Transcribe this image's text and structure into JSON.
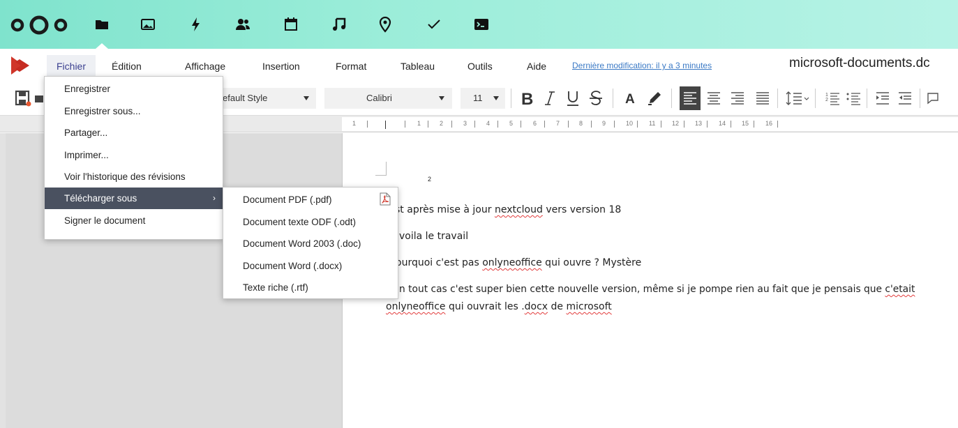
{
  "nextcloud": {
    "apps": [
      "logo-icon",
      "files-icon",
      "photos-icon",
      "activity-icon",
      "contacts-icon",
      "calendar-icon",
      "music-icon",
      "maps-icon",
      "tasks-icon",
      "terminal-icon"
    ]
  },
  "menubar": {
    "items": [
      "Fichier",
      "Édition",
      "Affichage",
      "Insertion",
      "Format",
      "Tableau",
      "Outils",
      "Aide"
    ],
    "last_modified": "Dernière modification:  il y a 3 minutes",
    "doc_title": "microsoft-documents.dc"
  },
  "toolbar": {
    "style_value": "efault Style",
    "font_value": "Calibri",
    "size_value": "11"
  },
  "ruler": {
    "labels": [
      "1",
      "1",
      "2",
      "3",
      "4",
      "5",
      "6",
      "7",
      "8",
      "9",
      "10",
      "11",
      "12",
      "13",
      "14",
      "15",
      "16"
    ]
  },
  "file_menu": {
    "items": [
      "Enregistrer",
      "Enregistrer sous...",
      "Partager...",
      "Imprimer...",
      "Voir l'historique des révisions",
      "Télécharger sous",
      "Signer le document"
    ],
    "submenu_arrow": "›"
  },
  "download_submenu": {
    "items": [
      "Document PDF (.pdf)",
      "Document texte ODF (.odt)",
      "Document Word 2003 (.doc)",
      "Document Word (.docx)",
      "Texte riche (.rtf)"
    ]
  },
  "document": {
    "superscript": "2",
    "line1_a": "st après mise à jour ",
    "line1_b": "nextcloud",
    "line1_c": " vers version 18",
    "line2": "voila le travail",
    "line3_a": "ourquoi c'est pas ",
    "line3_b": "onlyneoffice",
    "line3_c": " qui ouvre ? Mystère",
    "line4_a": "n tout cas c'est super bien cette nouvelle version, même si je pompe rien au fait que je pensais que ",
    "line4_b": "c'etait",
    "line5_a": "onlyneoffice",
    "line5_b": " qui ouvrait les .",
    "line5_c": "docx",
    "line5_d": " de ",
    "line5_e": "microsoft"
  }
}
